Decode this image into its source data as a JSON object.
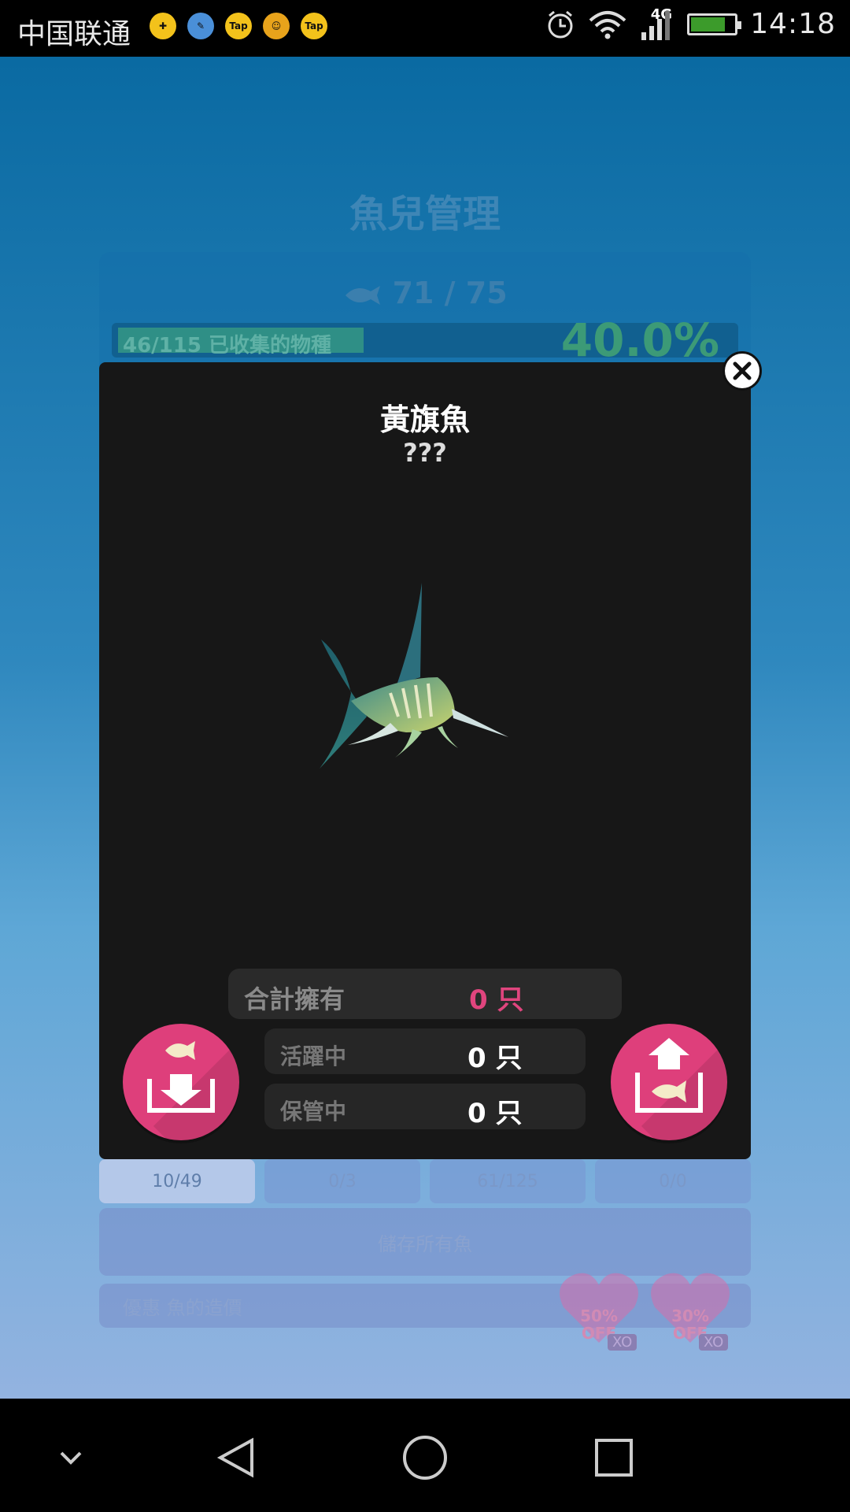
{
  "status_bar": {
    "carrier": "中国联通",
    "network": "4G",
    "time": "14:18",
    "app_icons": [
      "health-app-icon",
      "brush-app-icon",
      "tap-app-icon",
      "game-app-icon",
      "tap-app-icon"
    ],
    "app_icon_texts": [
      "Tap",
      "Tap"
    ]
  },
  "background": {
    "title": "魚兒管理",
    "fish_count": "71 / 75",
    "collection_text": "46/115 已收集的物種",
    "collection_percent": "40.0%",
    "collection_progress": 0.4,
    "tabs": [
      "10/49",
      "0/3",
      "61/125",
      "0/0"
    ],
    "store_all_label": "儲存所有魚",
    "promo_label": "優惠 魚的造價",
    "promo_badges": [
      {
        "label": "50%\nOFF",
        "tag": "XO"
      },
      {
        "label": "30%\nOFF",
        "tag": "XO"
      }
    ]
  },
  "modal": {
    "fish_name": "黃旗魚",
    "fish_subtitle": "???",
    "total_label": "合計擁有",
    "total_value": "0 只",
    "active_label": "活躍中",
    "active_value": "0 只",
    "stored_label": "保管中",
    "stored_value": "0 只"
  },
  "colors": {
    "accent_pink": "#de3f7b",
    "value_pink": "#e0457e",
    "modal_bg": "#171717"
  }
}
